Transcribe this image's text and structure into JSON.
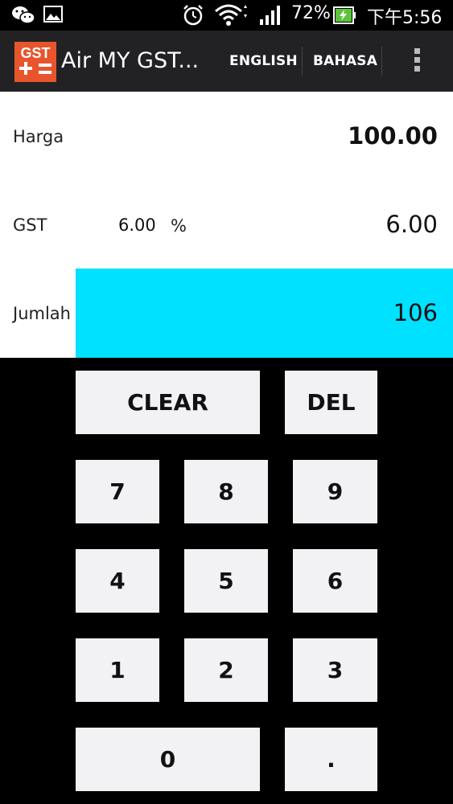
{
  "status_bar": {
    "battery_percent": "72%",
    "time": "下午5:56",
    "icons": [
      "wechat-icon",
      "gallery-icon",
      "alarm-icon",
      "wifi-icon",
      "signal-icon",
      "battery-charging-icon"
    ]
  },
  "action_bar": {
    "title": "Air MY GST...",
    "logo": {
      "top_text": "GST",
      "colors": {
        "background": "#E8542C",
        "text": "#ffffff"
      }
    },
    "english_label": "ENGLISH",
    "bahasa_label": "BAHASA",
    "overflow_icon": "more-vert-icon"
  },
  "form": {
    "price": {
      "label": "Harga",
      "value": "100.00"
    },
    "gst": {
      "label": "GST",
      "rate": "6.00",
      "percent_sign": "%",
      "value": "6.00"
    },
    "total": {
      "label": "Jumlah",
      "value": "106",
      "highlight_color": "#00E0FF"
    }
  },
  "keypad": {
    "clear": "CLEAR",
    "del": "DEL",
    "k7": "7",
    "k8": "8",
    "k9": "9",
    "k4": "4",
    "k5": "5",
    "k6": "6",
    "k1": "1",
    "k2": "2",
    "k3": "3",
    "k0": "0",
    "dot": "."
  }
}
